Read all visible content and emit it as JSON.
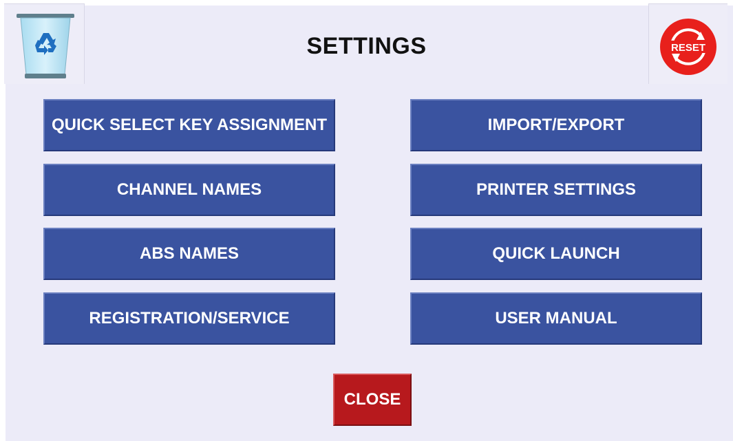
{
  "header": {
    "title": "SETTINGS",
    "left_icon": "recycle-bin-icon",
    "right_icon": "reset-icon",
    "reset_label": "RESET"
  },
  "buttons": {
    "quick_select": "QUICK SELECT KEY ASSIGNMENT",
    "import_export": "IMPORT/EXPORT",
    "channel_names": "CHANNEL NAMES",
    "printer_settings": "PRINTER SETTINGS",
    "abs_names": "ABS NAMES",
    "quick_launch": "QUICK LAUNCH",
    "registration_service": "REGISTRATION/SERVICE",
    "user_manual": "USER MANUAL",
    "close": "CLOSE"
  },
  "colors": {
    "background": "#ecebf8",
    "button_blue": "#3a53a0",
    "close_red": "#b7191d",
    "reset_red": "#e8201c",
    "bin_blue": "#7fc6e6"
  }
}
